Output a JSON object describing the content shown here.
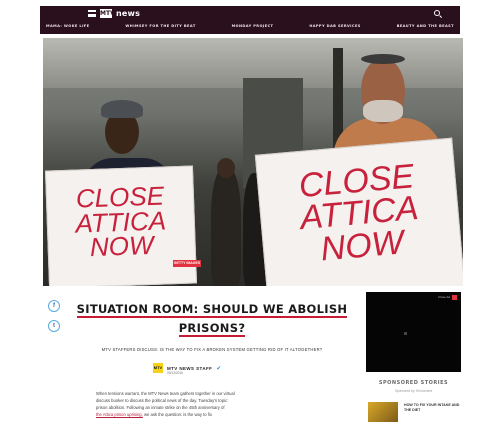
{
  "header": {
    "brand_mark": "MTV",
    "section": "news",
    "subnav": [
      "MAMA: WOKE LIFE",
      "WHIMSEY FOR THE DITY BEAT",
      "MONDAY PROJECT",
      "HAPPY DAB SERVICES",
      "BEAUTY AND THE BEAST"
    ]
  },
  "hero": {
    "sign_left": [
      "CLOSE",
      "ATTICA",
      "NOW"
    ],
    "sign_right": [
      "CLOSE",
      "ATTICA",
      "NOW"
    ],
    "tag": "GETTY IMAGES"
  },
  "share": {
    "facebook": "f",
    "twitter": "t"
  },
  "article": {
    "title_line1": "SITUATION ROOM: SHOULD WE ABOLISH",
    "title_line2": "PRISONS?",
    "subhead": "MTV STAFFERS DISCUSS: IS THE WAY TO FIX A BROKEN SYSTEM GETTING RID OF IT ALTOGETHER?",
    "author_logo": "MTV",
    "author": "MTV NEWS STAFF",
    "date": "09/13/2016",
    "body_1": "When tensions warrant, the MTV News team gathers together in our virtual",
    "body_2": "discuss bunker to discuss the political news of the day. Tuesday's topic:",
    "body_3": "prison abolition. Following an inmate strike on the 45th anniversary of",
    "body_link": "the Attica prison uprising,",
    "body_4": "we ask the question: is the way to fix"
  },
  "sidebar": {
    "video_label": "Close Ad",
    "sponsored_title": "SPONSORED STORIES",
    "sponsored_by": "Sponsored by: Revcontent",
    "promo_text": "HOW TO FIX YOUR INTAKE AND THE DIET"
  },
  "colors": {
    "header_bg": "#2a0f1d",
    "accent_red": "#c61b36",
    "twitter_blue": "#2a9be0"
  }
}
